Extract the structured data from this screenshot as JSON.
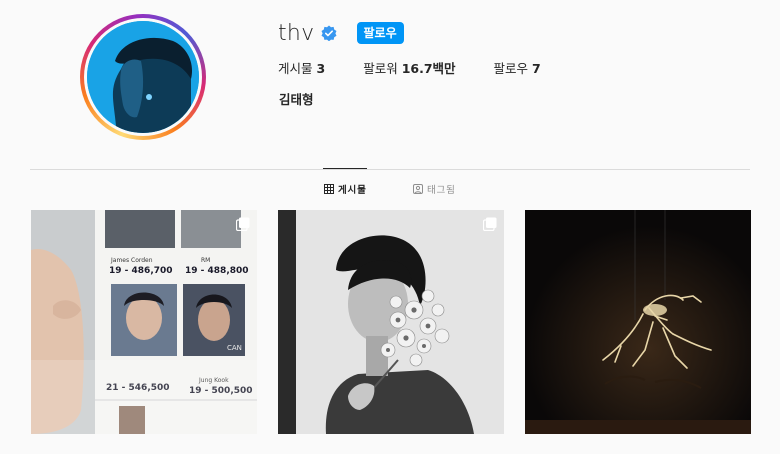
{
  "profile": {
    "username": "thv",
    "verified": true,
    "follow_label": "팔로우",
    "fullname": "김태형",
    "stats": {
      "posts_label": "게시물",
      "posts_value": "3",
      "followers_label": "팔로워",
      "followers_value": "16.7백만",
      "following_label": "팔로우",
      "following_value": "7"
    }
  },
  "tabs": {
    "posts_label": "게시물",
    "tagged_label": "태그됨"
  },
  "posts": [
    {
      "multi": true,
      "labels": [
        "James Corden",
        "RM",
        "19 - 486,700",
        "19 - 488,800",
        "21 - 546,500",
        "Jung Kook",
        "19 - 500,500",
        "CAN"
      ]
    },
    {
      "multi": true
    },
    {
      "multi": false
    }
  ],
  "colors": {
    "accent": "#0095f6",
    "verified": "#3897f0"
  }
}
